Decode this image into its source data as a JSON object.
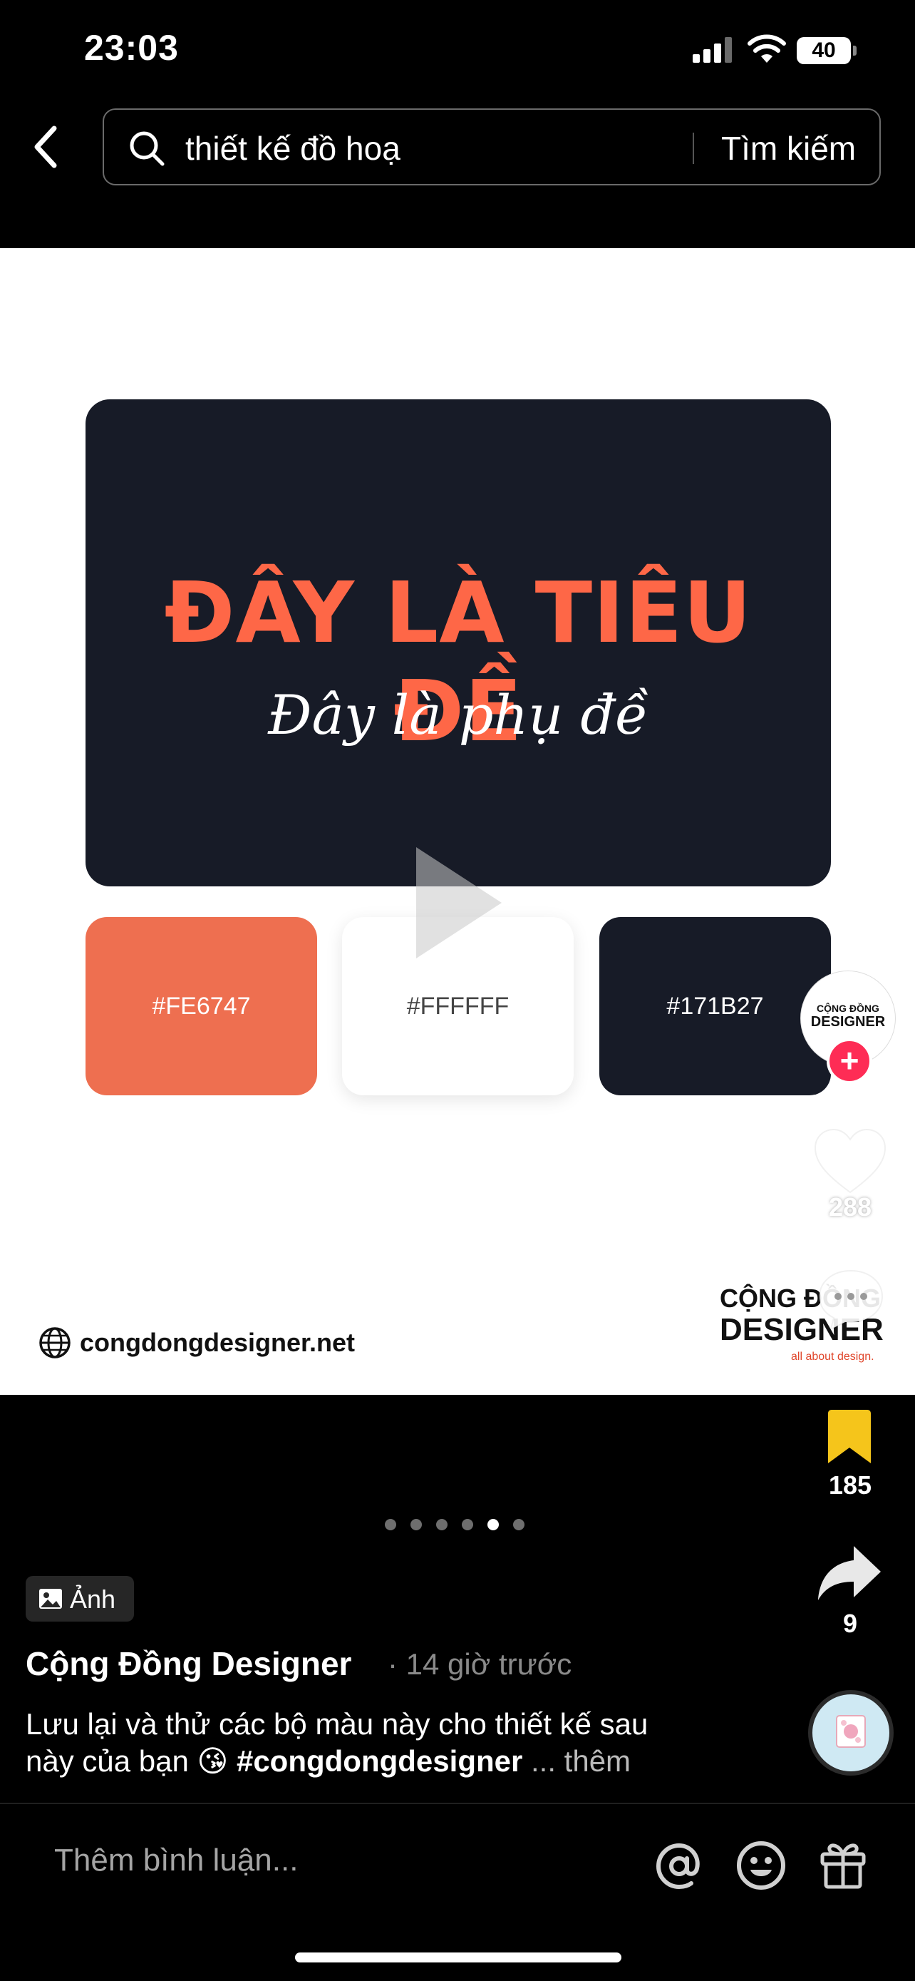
{
  "status_bar": {
    "time": "23:03",
    "battery": "40"
  },
  "search": {
    "query": "thiết kế đồ hoạ",
    "submit_label": "Tìm kiếm"
  },
  "post": {
    "card_title": "ĐÂY LÀ TIÊU ĐỀ",
    "card_subtitle": "Đây là phụ đề",
    "swatches": [
      {
        "label": "#FE6747",
        "color": "#FE6747"
      },
      {
        "label": "#FFFFFF",
        "color": "#FFFFFF"
      },
      {
        "label": "#171B27",
        "color": "#171B27"
      }
    ],
    "website": "congdongdesigner.net",
    "brand": {
      "line1": "CỘNG ĐỒNG",
      "line2": "DESIGNER",
      "tagline": "all about design."
    },
    "image_pager": {
      "total": 6,
      "active_index": 4
    }
  },
  "creator_avatar": {
    "line1": "CỘNG ĐỒNG",
    "line2": "DESIGNER"
  },
  "actions": {
    "like_count": "288",
    "bookmark_count": "185",
    "share_count": "9"
  },
  "caption_area": {
    "type_label": "Ảnh",
    "author": "Cộng Đồng Designer",
    "time": "· 14 giờ trước",
    "caption_line1": "Lưu lại và thử các bộ màu này cho thiết kế sau",
    "caption_line2_prefix": "này của bạn 😘 ",
    "hashtag": "#congdongdesigner",
    "more": " ... thêm"
  },
  "comment_bar": {
    "placeholder": "Thêm bình luận..."
  },
  "icons": [
    "signal-icon",
    "wifi-icon",
    "battery-icon",
    "back-icon",
    "search-icon",
    "play-icon",
    "globe-icon",
    "plus-icon",
    "heart-icon",
    "comment-icon",
    "bookmark-icon",
    "share-icon",
    "photo-icon",
    "music-disc-icon",
    "mention-icon",
    "emoji-icon",
    "gift-icon"
  ],
  "colors": {
    "accent": "#FE6747",
    "dark": "#171B27",
    "bookmark": "#F5C51B",
    "follow": "#FE2C55"
  }
}
